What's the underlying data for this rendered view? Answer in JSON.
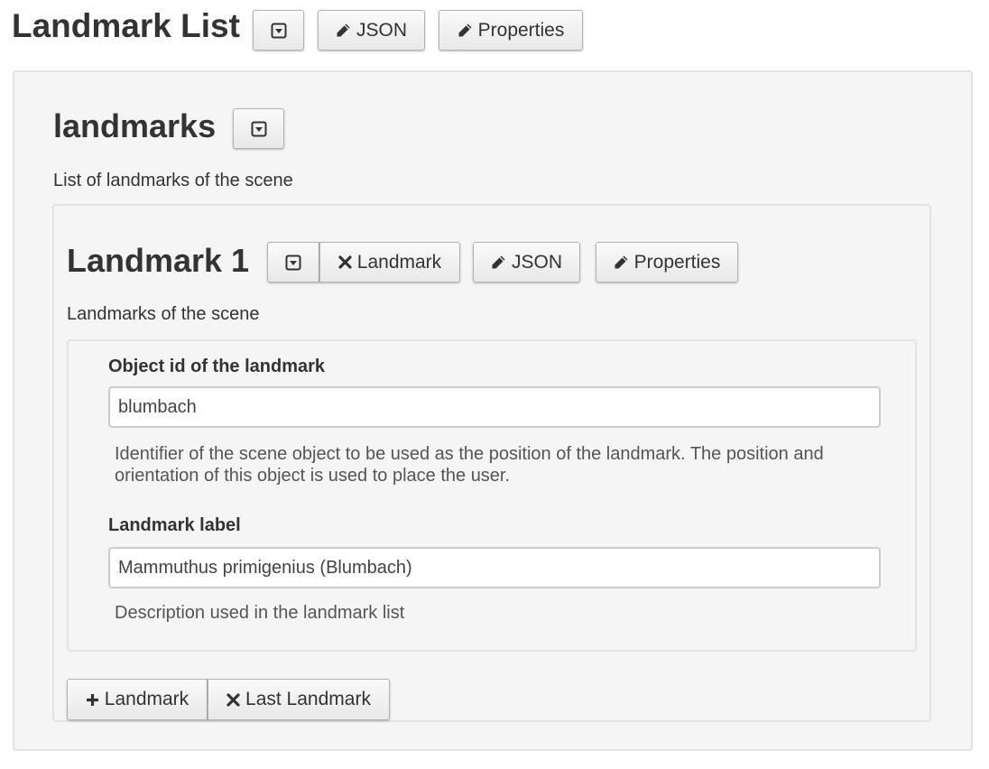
{
  "header": {
    "title": "Landmark List",
    "json_label": "JSON",
    "properties_label": "Properties"
  },
  "landmarks_section": {
    "title": "landmarks",
    "description": "List of landmarks of the scene"
  },
  "item": {
    "title": "Landmark 1",
    "delete_label": "Landmark",
    "json_label": "JSON",
    "properties_label": "Properties",
    "description": "Landmarks of the scene",
    "fields": [
      {
        "label": "Object id of the landmark",
        "value": "blumbach",
        "help": "Identifier of the scene object to be used as the position of the landmark. The position and orientation of this object is used to place the user."
      },
      {
        "label": "Landmark label",
        "value": "Mammuthus primigenius (Blumbach)",
        "help": "Description used in the landmark list"
      }
    ]
  },
  "footer": {
    "add_label": "Landmark",
    "delete_last_label": "Last Landmark"
  },
  "icons": {
    "collapse": "collapse-icon",
    "edit": "pencil-icon",
    "delete": "times-icon",
    "add": "plus-icon"
  },
  "colors": {
    "panel_bg": "#f5f5f5",
    "panel_border": "#e3e3e3",
    "button_gradient_top": "#fafafa",
    "button_gradient_bottom": "#e8e8e8"
  }
}
